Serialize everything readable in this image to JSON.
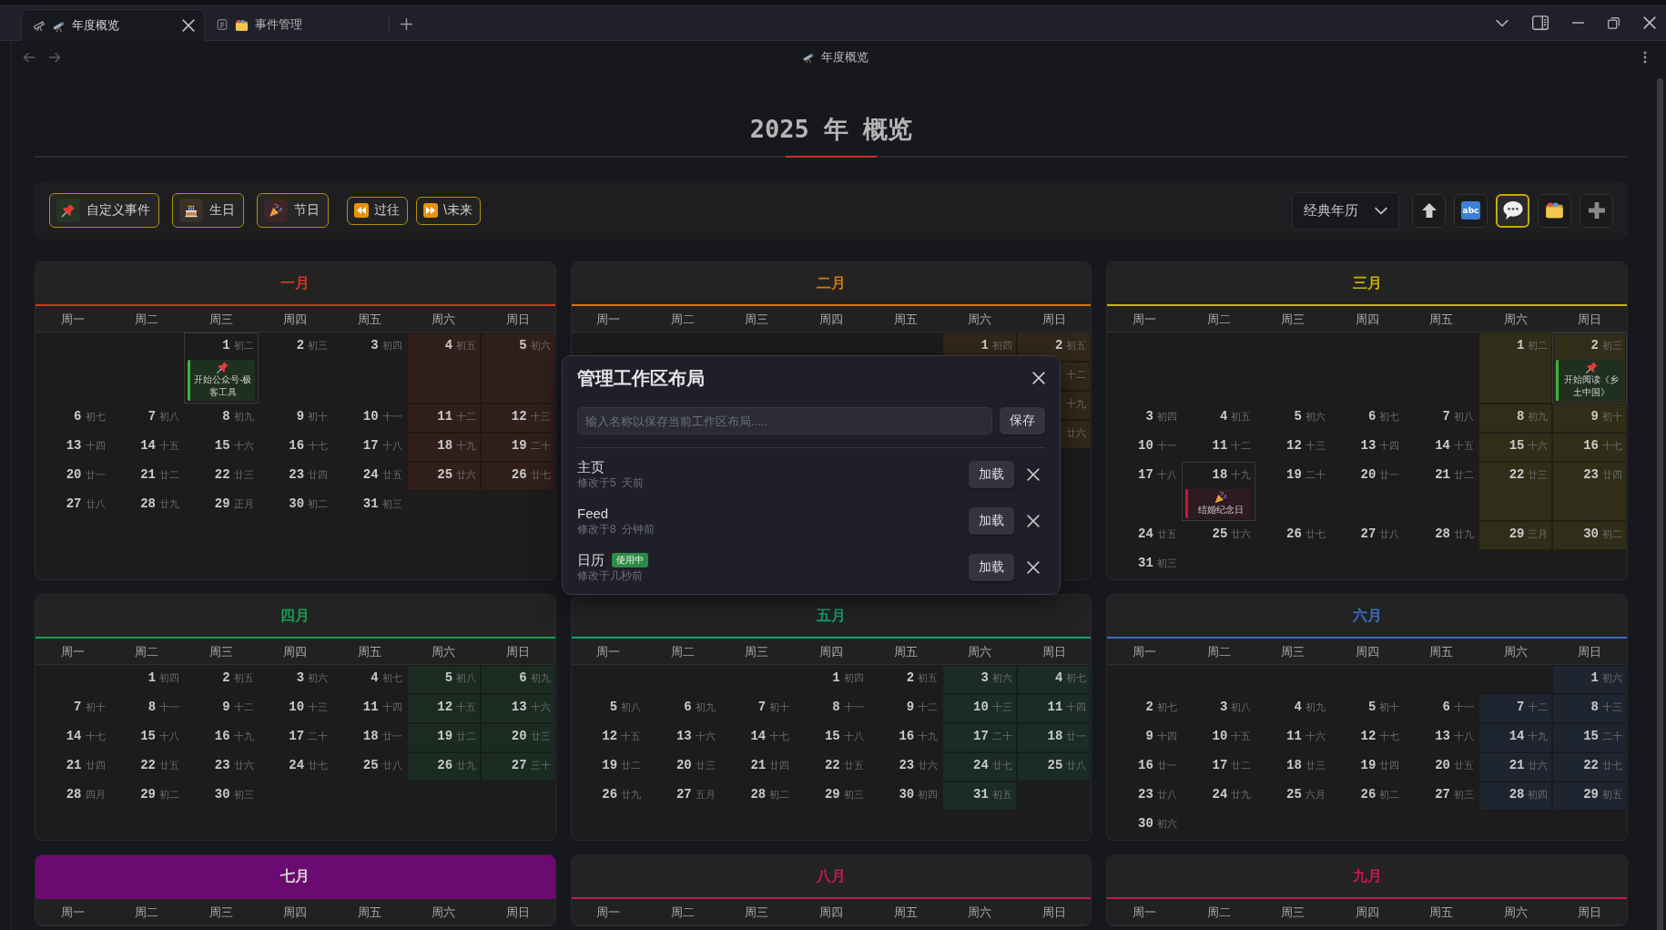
{
  "tabs": [
    {
      "kind": "telescope",
      "title": "年度概览",
      "selected": true
    },
    {
      "kind": "folder",
      "title": "事件管理",
      "selected": false
    }
  ],
  "header": {
    "title": "年度概览"
  },
  "page_title": "2025 年 概览",
  "toolbar": {
    "filters": [
      {
        "kind": "custom",
        "label": "自定义事件"
      },
      {
        "kind": "birthday",
        "label": "生日"
      },
      {
        "kind": "holiday",
        "label": "节日"
      }
    ],
    "navigation": [
      {
        "kind": "past",
        "label": "过往"
      },
      {
        "kind": "future",
        "label": "\\未来"
      }
    ],
    "view_select": {
      "value": "经典年历"
    },
    "actions": [
      {
        "kind": "up",
        "selected": false
      },
      {
        "kind": "text",
        "label": "abc",
        "selected": false
      },
      {
        "kind": "comment",
        "selected": true
      },
      {
        "kind": "folder",
        "selected": false
      },
      {
        "kind": "add",
        "selected": false
      }
    ]
  },
  "months": [
    {
      "title": "一月",
      "color": "#cf3a1e",
      "filled": false,
      "weekdays": [
        "周一",
        "周二",
        "周三",
        "周四",
        "周五",
        "周六",
        "周日"
      ],
      "weeks": [
        {
          "kind": "leading",
          "days": [
            {
              "day": "1",
              "lunar": "初二",
              "event": {
                "kind": "custom",
                "text": "开始公众号-极客工具"
              }
            },
            {
              "day": "2",
              "lunar": "初三"
            },
            {
              "day": "3",
              "lunar": "初四"
            },
            {
              "day": "4",
              "lunar": "初五"
            },
            {
              "day": "5",
              "lunar": "初六"
            }
          ]
        },
        {
          "kind": "full",
          "days": [
            {
              "day": "6",
              "lunar": "初七"
            },
            {
              "day": "7",
              "lunar": "初八"
            },
            {
              "day": "8",
              "lunar": "初九"
            },
            {
              "day": "9",
              "lunar": "初十"
            },
            {
              "day": "10",
              "lunar": "十一"
            },
            {
              "day": "11",
              "lunar": "十二"
            },
            {
              "day": "12",
              "lunar": "十三"
            }
          ]
        },
        {
          "kind": "full",
          "days": [
            {
              "day": "13",
              "lunar": "十四"
            },
            {
              "day": "14",
              "lunar": "十五"
            },
            {
              "day": "15",
              "lunar": "十六"
            },
            {
              "day": "16",
              "lunar": "十七"
            },
            {
              "day": "17",
              "lunar": "十八"
            },
            {
              "day": "18",
              "lunar": "十九"
            },
            {
              "day": "19",
              "lunar": "二十"
            }
          ]
        },
        {
          "kind": "full",
          "days": [
            {
              "day": "20",
              "lunar": "廿一"
            },
            {
              "day": "21",
              "lunar": "廿二"
            },
            {
              "day": "22",
              "lunar": "廿三"
            },
            {
              "day": "23",
              "lunar": "廿四"
            },
            {
              "day": "24",
              "lunar": "廿五"
            },
            {
              "day": "25",
              "lunar": "廿六"
            },
            {
              "day": "26",
              "lunar": "廿七"
            }
          ]
        },
        {
          "kind": "trailing",
          "days": [
            {
              "day": "27",
              "lunar": "廿八"
            },
            {
              "day": "28",
              "lunar": "廿九"
            },
            {
              "day": "29",
              "lunar": "正月"
            },
            {
              "day": "30",
              "lunar": "初二"
            },
            {
              "day": "31",
              "lunar": "初三"
            }
          ]
        }
      ]
    },
    {
      "title": "二月",
      "color": "#d2780e",
      "filled": false,
      "weekdays": [
        "周一",
        "周二",
        "周三",
        "周四",
        "周五",
        "周六",
        "周日"
      ],
      "weeks": [
        {
          "kind": "leading",
          "days": [
            {
              "day": "1",
              "lunar": "初四"
            },
            {
              "day": "2",
              "lunar": "初五"
            }
          ]
        },
        {
          "kind": "leading",
          "days": [
            {
              "lunar": "十二"
            }
          ]
        },
        {
          "kind": "leading",
          "days": [
            {
              "lunar": "十九"
            }
          ]
        },
        {
          "kind": "leading",
          "days": [
            {
              "lunar": "廿六"
            }
          ]
        }
      ]
    },
    {
      "title": "三月",
      "color": "#c8b400",
      "filled": false,
      "weekdays": [
        "周一",
        "周二",
        "周三",
        "周四",
        "周五",
        "周六",
        "周日"
      ],
      "weeks": [
        {
          "kind": "leading",
          "days": [
            {
              "day": "1",
              "lunar": "初二"
            },
            {
              "day": "2",
              "lunar": "初三",
              "event": {
                "kind": "custom",
                "text": "开始阅读《乡土中国》"
              }
            }
          ]
        },
        {
          "kind": "full",
          "days": [
            {
              "day": "3",
              "lunar": "初四"
            },
            {
              "day": "4",
              "lunar": "初五"
            },
            {
              "day": "5",
              "lunar": "初六"
            },
            {
              "day": "6",
              "lunar": "初七"
            },
            {
              "day": "7",
              "lunar": "初八"
            },
            {
              "day": "8",
              "lunar": "初九"
            },
            {
              "day": "9",
              "lunar": "初十"
            }
          ]
        },
        {
          "kind": "full",
          "days": [
            {
              "day": "10",
              "lunar": "十一"
            },
            {
              "day": "11",
              "lunar": "十二"
            },
            {
              "day": "12",
              "lunar": "十三"
            },
            {
              "day": "13",
              "lunar": "十四"
            },
            {
              "day": "14",
              "lunar": "十五"
            },
            {
              "day": "15",
              "lunar": "十六"
            },
            {
              "day": "16",
              "lunar": "十七"
            }
          ]
        },
        {
          "kind": "full",
          "days": [
            {
              "day": "17",
              "lunar": "十八"
            },
            {
              "day": "18",
              "lunar": "十九",
              "event": {
                "kind": "holiday",
                "text": "结婚纪念日"
              }
            },
            {
              "day": "19",
              "lunar": "二十"
            },
            {
              "day": "20",
              "lunar": "廿一"
            },
            {
              "day": "21",
              "lunar": "廿二"
            },
            {
              "day": "22",
              "lunar": "廿三"
            },
            {
              "day": "23",
              "lunar": "廿四"
            }
          ]
        },
        {
          "kind": "full",
          "days": [
            {
              "day": "24",
              "lunar": "廿五"
            },
            {
              "day": "25",
              "lunar": "廿六"
            },
            {
              "day": "26",
              "lunar": "廿七"
            },
            {
              "day": "27",
              "lunar": "廿八"
            },
            {
              "day": "28",
              "lunar": "廿九"
            },
            {
              "day": "29",
              "lunar": "三月"
            },
            {
              "day": "30",
              "lunar": "初二"
            }
          ]
        },
        {
          "kind": "trailing",
          "days": [
            {
              "day": "31",
              "lunar": "初三"
            }
          ]
        }
      ]
    },
    {
      "title": "四月",
      "color": "#1c9e52",
      "filled": false,
      "weekdays": [
        "周一",
        "周二",
        "周三",
        "周四",
        "周五",
        "周六",
        "周日"
      ],
      "weeks": [
        {
          "kind": "leading",
          "days": [
            {
              "day": "1",
              "lunar": "初四"
            },
            {
              "day": "2",
              "lunar": "初五"
            },
            {
              "day": "3",
              "lunar": "初六"
            },
            {
              "day": "4",
              "lunar": "初七"
            },
            {
              "day": "5",
              "lunar": "初八"
            },
            {
              "day": "6",
              "lunar": "初九"
            }
          ]
        },
        {
          "kind": "full",
          "days": [
            {
              "day": "7",
              "lunar": "初十"
            },
            {
              "day": "8",
              "lunar": "十一"
            },
            {
              "day": "9",
              "lunar": "十二"
            },
            {
              "day": "10",
              "lunar": "十三"
            },
            {
              "day": "11",
              "lunar": "十四"
            },
            {
              "day": "12",
              "lunar": "十五"
            },
            {
              "day": "13",
              "lunar": "十六"
            }
          ]
        },
        {
          "kind": "full",
          "days": [
            {
              "day": "14",
              "lunar": "十七"
            },
            {
              "day": "15",
              "lunar": "十八"
            },
            {
              "day": "16",
              "lunar": "十九"
            },
            {
              "day": "17",
              "lunar": "二十"
            },
            {
              "day": "18",
              "lunar": "廿一"
            },
            {
              "day": "19",
              "lunar": "廿二"
            },
            {
              "day": "20",
              "lunar": "廿三"
            }
          ]
        },
        {
          "kind": "full",
          "days": [
            {
              "day": "21",
              "lunar": "廿四"
            },
            {
              "day": "22",
              "lunar": "廿五"
            },
            {
              "day": "23",
              "lunar": "廿六"
            },
            {
              "day": "24",
              "lunar": "廿七"
            },
            {
              "day": "25",
              "lunar": "廿八"
            },
            {
              "day": "26",
              "lunar": "廿九"
            },
            {
              "day": "27",
              "lunar": "三十"
            }
          ]
        },
        {
          "kind": "trailing",
          "days": [
            {
              "day": "28",
              "lunar": "四月"
            },
            {
              "day": "29",
              "lunar": "初二"
            },
            {
              "day": "30",
              "lunar": "初三"
            }
          ]
        }
      ]
    },
    {
      "title": "五月",
      "color": "#17a07a",
      "filled": false,
      "weekdays": [
        "周一",
        "周二",
        "周三",
        "周四",
        "周五",
        "周六",
        "周日"
      ],
      "weeks": [
        {
          "kind": "leading",
          "days": [
            {
              "day": "1",
              "lunar": "初四"
            },
            {
              "day": "2",
              "lunar": "初五"
            },
            {
              "day": "3",
              "lunar": "初六"
            },
            {
              "day": "4",
              "lunar": "初七"
            }
          ]
        },
        {
          "kind": "full",
          "days": [
            {
              "day": "5",
              "lunar": "初八"
            },
            {
              "day": "6",
              "lunar": "初九"
            },
            {
              "day": "7",
              "lunar": "初十"
            },
            {
              "day": "8",
              "lunar": "十一"
            },
            {
              "day": "9",
              "lunar": "十二"
            },
            {
              "day": "10",
              "lunar": "十三"
            },
            {
              "day": "11",
              "lunar": "十四"
            }
          ]
        },
        {
          "kind": "full",
          "days": [
            {
              "day": "12",
              "lunar": "十五"
            },
            {
              "day": "13",
              "lunar": "十六"
            },
            {
              "day": "14",
              "lunar": "十七"
            },
            {
              "day": "15",
              "lunar": "十八"
            },
            {
              "day": "16",
              "lunar": "十九"
            },
            {
              "day": "17",
              "lunar": "二十"
            },
            {
              "day": "18",
              "lunar": "廿一"
            }
          ]
        },
        {
          "kind": "full",
          "days": [
            {
              "day": "19",
              "lunar": "廿二"
            },
            {
              "day": "20",
              "lunar": "廿三"
            },
            {
              "day": "21",
              "lunar": "廿四"
            },
            {
              "day": "22",
              "lunar": "廿五"
            },
            {
              "day": "23",
              "lunar": "廿六"
            },
            {
              "day": "24",
              "lunar": "廿七"
            },
            {
              "day": "25",
              "lunar": "廿八"
            }
          ]
        },
        {
          "kind": "trailing",
          "days": [
            {
              "day": "26",
              "lunar": "廿九"
            },
            {
              "day": "27",
              "lunar": "五月"
            },
            {
              "day": "28",
              "lunar": "初二"
            },
            {
              "day": "29",
              "lunar": "初三"
            },
            {
              "day": "30",
              "lunar": "初四"
            },
            {
              "day": "31",
              "lunar": "初五"
            }
          ]
        }
      ]
    },
    {
      "title": "六月",
      "color": "#3b6cc2",
      "filled": false,
      "weekdays": [
        "周一",
        "周二",
        "周三",
        "周四",
        "周五",
        "周六",
        "周日"
      ],
      "weeks": [
        {
          "kind": "leading",
          "days": [
            {
              "day": "1",
              "lunar": "初六"
            }
          ]
        },
        {
          "kind": "full",
          "days": [
            {
              "day": "2",
              "lunar": "初七"
            },
            {
              "day": "3",
              "lunar": "初八"
            },
            {
              "day": "4",
              "lunar": "初九"
            },
            {
              "day": "5",
              "lunar": "初十"
            },
            {
              "day": "6",
              "lunar": "十一"
            },
            {
              "day": "7",
              "lunar": "十二"
            },
            {
              "day": "8",
              "lunar": "十三"
            }
          ]
        },
        {
          "kind": "full",
          "days": [
            {
              "day": "9",
              "lunar": "十四"
            },
            {
              "day": "10",
              "lunar": "十五"
            },
            {
              "day": "11",
              "lunar": "十六"
            },
            {
              "day": "12",
              "lunar": "十七"
            },
            {
              "day": "13",
              "lunar": "十八"
            },
            {
              "day": "14",
              "lunar": "十九"
            },
            {
              "day": "15",
              "lunar": "二十"
            }
          ]
        },
        {
          "kind": "full",
          "days": [
            {
              "day": "16",
              "lunar": "廿一"
            },
            {
              "day": "17",
              "lunar": "廿二"
            },
            {
              "day": "18",
              "lunar": "廿三"
            },
            {
              "day": "19",
              "lunar": "廿四"
            },
            {
              "day": "20",
              "lunar": "廿五"
            },
            {
              "day": "21",
              "lunar": "廿六"
            },
            {
              "day": "22",
              "lunar": "廿七"
            }
          ]
        },
        {
          "kind": "full",
          "days": [
            {
              "day": "23",
              "lunar": "廿八"
            },
            {
              "day": "24",
              "lunar": "廿九"
            },
            {
              "day": "25",
              "lunar": "六月"
            },
            {
              "day": "26",
              "lunar": "初二"
            },
            {
              "day": "27",
              "lunar": "初三"
            },
            {
              "day": "28",
              "lunar": "初四"
            },
            {
              "day": "29",
              "lunar": "初五"
            }
          ]
        },
        {
          "kind": "trailing",
          "days": [
            {
              "day": "30",
              "lunar": "初六"
            }
          ]
        }
      ]
    },
    {
      "title": "七月",
      "color": "#6b0a70",
      "filled": true,
      "weekdays": [
        "周一",
        "周二",
        "周三",
        "周四",
        "周五",
        "周六",
        "周日"
      ]
    },
    {
      "title": "八月",
      "color": "#c41858",
      "filled": false,
      "weekdays": [
        "周一",
        "周二",
        "周三",
        "周四",
        "周五",
        "周六",
        "周日"
      ]
    },
    {
      "title": "九月",
      "color": "#c41858",
      "filled": false,
      "weekdays": [
        "周一",
        "周二",
        "周三",
        "周四",
        "周五",
        "周六",
        "周日"
      ]
    }
  ],
  "dialog": {
    "title": "管理工作区布局",
    "input": {
      "placeholder": "输入名称以保存当前工作区布局....."
    },
    "save": "保存",
    "layouts": [
      {
        "name": "主页",
        "modified": "修改于5  天前",
        "load": "加载"
      },
      {
        "name": "Feed",
        "modified": "修改于8  分钟前",
        "load": "加载"
      },
      {
        "name": "日历",
        "badge": "使用中",
        "modified": "修改于几秒前",
        "load": "加载"
      }
    ]
  }
}
